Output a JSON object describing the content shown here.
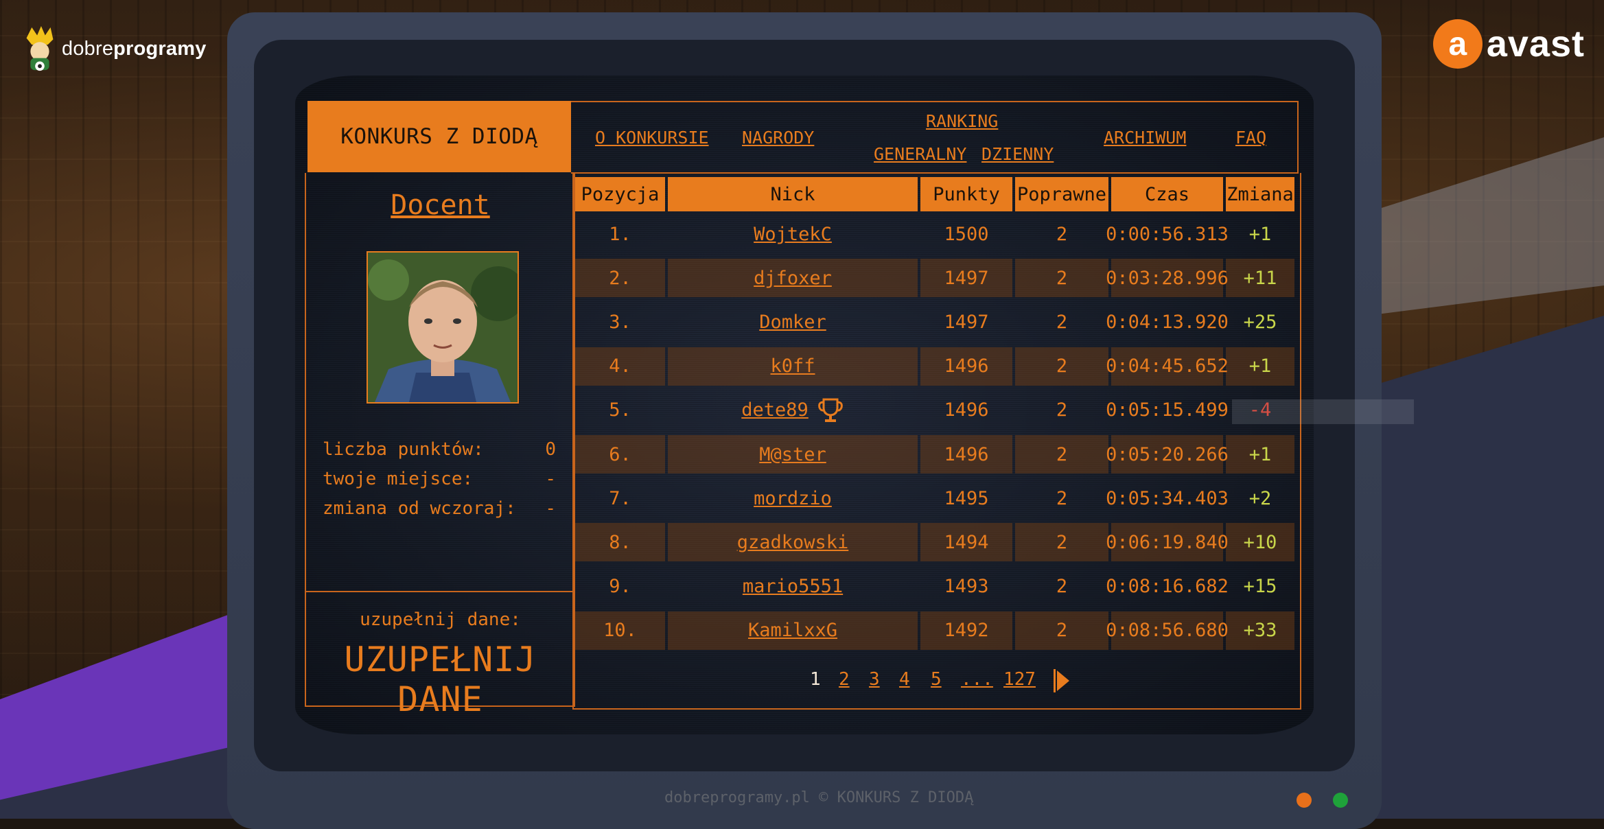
{
  "brand": {
    "dp_light": "dobre",
    "dp_bold": "programy",
    "avast_letter": "a",
    "avast_word": "avast"
  },
  "header": {
    "title": "KONKURS Z DIODĄ",
    "nav": {
      "about": "O KONKURSIE",
      "prizes": "NAGRODY",
      "ranking": "RANKING",
      "general": "GENERALNY",
      "daily": "DZIENNY",
      "archive": "ARCHIWUM",
      "faq": "FAQ"
    }
  },
  "profile": {
    "nick": "Docent",
    "stats": [
      {
        "label": "liczba punktów:",
        "value": "0"
      },
      {
        "label": "twoje miejsce:",
        "value": "-"
      },
      {
        "label": "zmiana od wczoraj:",
        "value": "-"
      }
    ],
    "fill_label": "uzupełnij dane:",
    "fill_button": "UZUPEŁNIJ DANE"
  },
  "table": {
    "columns": [
      "Pozycja",
      "Nick",
      "Punkty",
      "Poprawne",
      "Czas",
      "Zmiana"
    ],
    "rows": [
      {
        "pos": "1.",
        "nick": "WojtekC",
        "points": "1500",
        "correct": "2",
        "time": "0:00:56.313",
        "change": "+1"
      },
      {
        "pos": "2.",
        "nick": "djfoxer",
        "points": "1497",
        "correct": "2",
        "time": "0:03:28.996",
        "change": "+11"
      },
      {
        "pos": "3.",
        "nick": "Domker",
        "points": "1497",
        "correct": "2",
        "time": "0:04:13.920",
        "change": "+25"
      },
      {
        "pos": "4.",
        "nick": "k0ff",
        "points": "1496",
        "correct": "2",
        "time": "0:04:45.652",
        "change": "+1"
      },
      {
        "pos": "5.",
        "nick": "dete89",
        "points": "1496",
        "correct": "2",
        "time": "0:05:15.499",
        "change": "-4"
      },
      {
        "pos": "6.",
        "nick": "M@ster",
        "points": "1496",
        "correct": "2",
        "time": "0:05:20.266",
        "change": "+1"
      },
      {
        "pos": "7.",
        "nick": "mordzio",
        "points": "1495",
        "correct": "2",
        "time": "0:05:34.403",
        "change": "+2"
      },
      {
        "pos": "8.",
        "nick": "gzadkowski",
        "points": "1494",
        "correct": "2",
        "time": "0:06:19.840",
        "change": "+10"
      },
      {
        "pos": "9.",
        "nick": "mario5551",
        "points": "1493",
        "correct": "2",
        "time": "0:08:16.682",
        "change": "+15"
      },
      {
        "pos": "10.",
        "nick": "KamilxxG",
        "points": "1492",
        "correct": "2",
        "time": "0:08:56.680",
        "change": "+33"
      }
    ]
  },
  "pagination": {
    "pages": [
      "1",
      "2",
      "3",
      "4",
      "5",
      "...",
      "127"
    ],
    "current": "1",
    "next_icon": "play-arrow-icon"
  },
  "footer": {
    "text": "dobreprogramy.pl © KONKURS Z DIODĄ"
  },
  "leds": {
    "left_color": "#e8701a",
    "right_color": "#1fa23a"
  },
  "colors": {
    "accent": "#e87c1e",
    "change_positive": "#c9d64a",
    "change_negative": "#e03a2a"
  },
  "icons": {
    "trophy": "trophy-icon",
    "crown": "crown-logo-icon"
  }
}
